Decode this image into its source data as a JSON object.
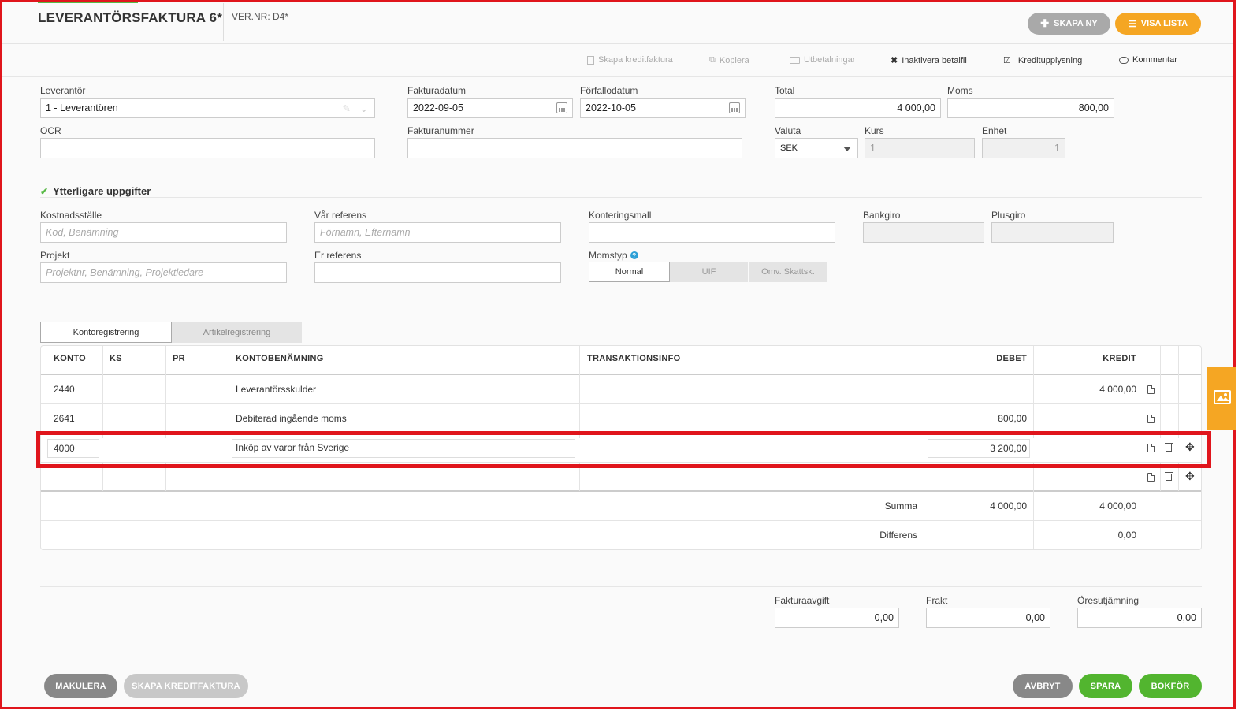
{
  "header": {
    "title": "LEVERANTÖRSFAKTURA 6*",
    "ver_nr": "VER.NR: D4*",
    "skapa_ny": "SKAPA NY",
    "visa_lista": "VISA LISTA"
  },
  "toolbar": {
    "skapa_kreditfaktura": "Skapa kreditfaktura",
    "kopiera": "Kopiera",
    "utbetalningar": "Utbetalningar",
    "inaktivera_betalfil": "Inaktivera betalfil",
    "kreditupplysning": "Kreditupplysning",
    "kommentar": "Kommentar"
  },
  "form": {
    "leverantor_label": "Leverantör",
    "leverantor_value": "1 - Leverantören",
    "fakturadatum_label": "Fakturadatum",
    "fakturadatum_value": "2022-09-05",
    "forfallodatum_label": "Förfallodatum",
    "forfallodatum_value": "2022-10-05",
    "total_label": "Total",
    "total_value": "4 000,00",
    "moms_label": "Moms",
    "moms_value": "800,00",
    "ocr_label": "OCR",
    "fakturanummer_label": "Fakturanummer",
    "valuta_label": "Valuta",
    "valuta_value": "SEK",
    "kurs_label": "Kurs",
    "kurs_value": "1",
    "enhet_label": "Enhet",
    "enhet_value": "1"
  },
  "extra": {
    "section_title": "Ytterligare uppgifter",
    "kostnadsstalle_label": "Kostnadsställe",
    "kostnadsstalle_placeholder": "Kod, Benämning",
    "var_referens_label": "Vår referens",
    "var_referens_placeholder": "Förnamn, Efternamn",
    "konteringsmall_label": "Konteringsmall",
    "bankgiro_label": "Bankgiro",
    "plusgiro_label": "Plusgiro",
    "projekt_label": "Projekt",
    "projekt_placeholder": "Projektnr, Benämning, Projektledare",
    "er_referens_label": "Er referens",
    "momstyp_label": "Momstyp",
    "momstyp_options": [
      "Normal",
      "UIF",
      "Omv. Skattsk."
    ]
  },
  "tabs": [
    "Kontoregistrering",
    "Artikelregistrering"
  ],
  "table": {
    "headers": [
      "KONTO",
      "KS",
      "PR",
      "KONTOBENÄMNING",
      "TRANSAKTIONSINFO",
      "DEBET",
      "KREDIT"
    ],
    "rows": [
      {
        "konto": "2440",
        "ks": "",
        "pr": "",
        "benamning": "Leverantörsskulder",
        "info": "",
        "debet": "",
        "kredit": "4 000,00"
      },
      {
        "konto": "2641",
        "ks": "",
        "pr": "",
        "benamning": "Debiterad ingående moms",
        "info": "",
        "debet": "800,00",
        "kredit": ""
      },
      {
        "konto": "4000",
        "ks": "",
        "pr": "",
        "benamning": "Inköp av varor från Sverige",
        "info": "",
        "debet": "3 200,00",
        "kredit": ""
      }
    ],
    "summa_label": "Summa",
    "summa_debet": "4 000,00",
    "summa_kredit": "4 000,00",
    "differens_label": "Differens",
    "differens_value": "0,00"
  },
  "fees": {
    "fakturaavgift_label": "Fakturaavgift",
    "fakturaavgift_value": "0,00",
    "frakt_label": "Frakt",
    "frakt_value": "0,00",
    "oresutjamning_label": "Öresutjämning",
    "oresutjamning_value": "0,00"
  },
  "footer": {
    "makulera": "MAKULERA",
    "skapa_kreditfaktura": "SKAPA KREDITFAKTURA",
    "avbryt": "AVBRYT",
    "spara": "SPARA",
    "bokfor": "BOKFÖR"
  },
  "colors": {
    "accent_orange": "#f5a623",
    "green": "#58b947",
    "highlight_red": "#e0151c",
    "grey_button": "#888888"
  }
}
